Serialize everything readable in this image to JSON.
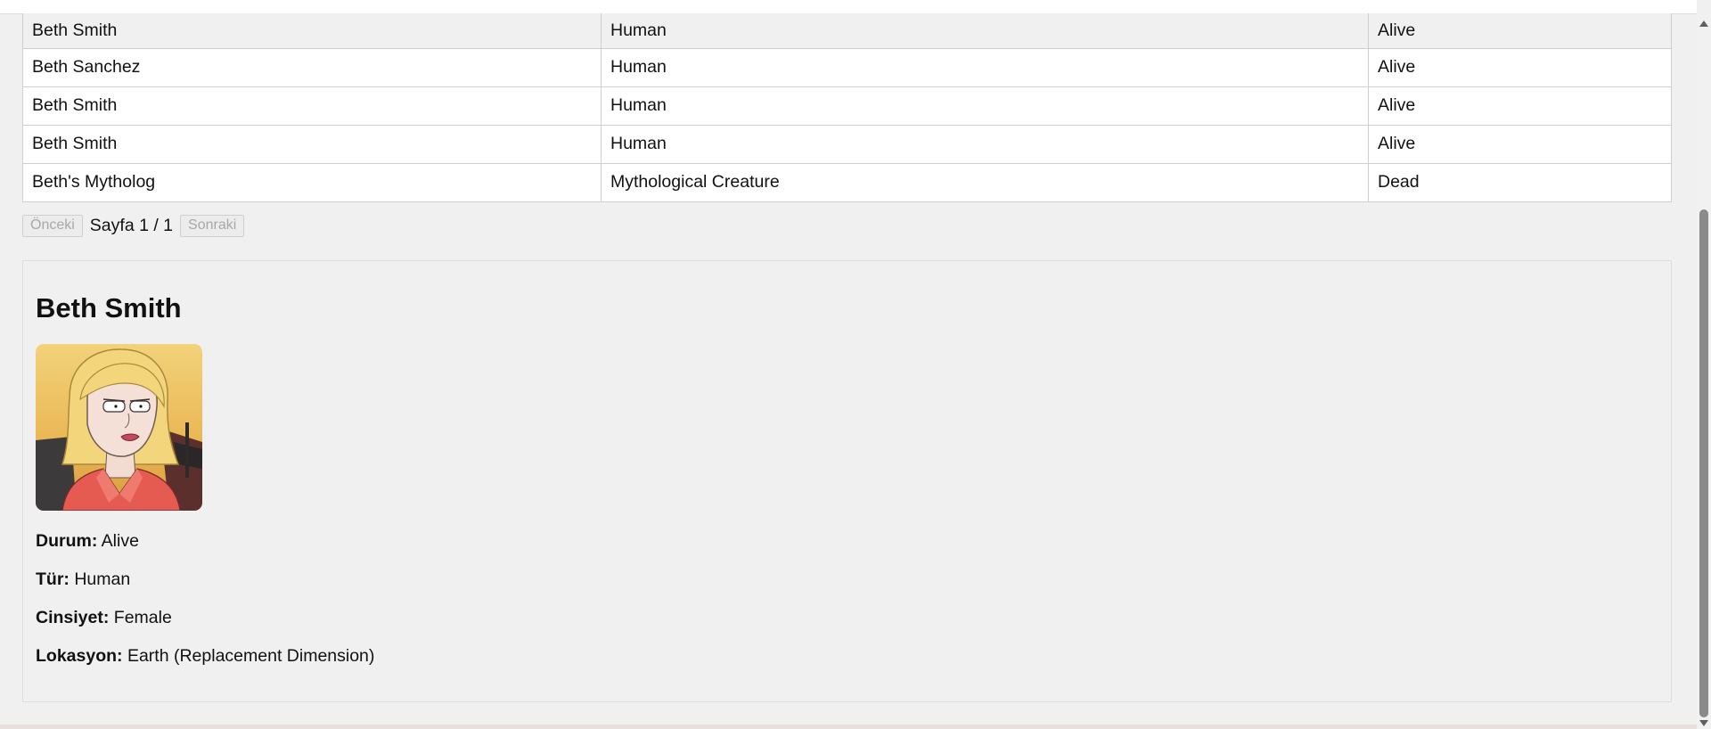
{
  "table": {
    "rows": [
      {
        "name": "Beth Smith",
        "species": "Human",
        "status": "Alive"
      },
      {
        "name": "Beth Sanchez",
        "species": "Human",
        "status": "Alive"
      },
      {
        "name": "Beth Smith",
        "species": "Human",
        "status": "Alive"
      },
      {
        "name": "Beth Smith",
        "species": "Human",
        "status": "Alive"
      },
      {
        "name": "Beth's Mytholog",
        "species": "Mythological Creature",
        "status": "Dead"
      }
    ]
  },
  "pagination": {
    "prev_label": "Önceki",
    "page_info": "Sayfa 1 / 1",
    "next_label": "Sonraki"
  },
  "detail": {
    "name": "Beth Smith",
    "fields": [
      {
        "label": "Durum:",
        "value": "Alive"
      },
      {
        "label": "Tür:",
        "value": "Human"
      },
      {
        "label": "Cinsiyet:",
        "value": "Female"
      },
      {
        "label": "Lokasyon:",
        "value": "Earth (Replacement Dimension)"
      }
    ]
  },
  "colors": {
    "page_bg": "#f0f0f0",
    "table_bg": "#ffffff",
    "border": "#cfcfcf",
    "disabled_text": "#a8a8a8"
  }
}
